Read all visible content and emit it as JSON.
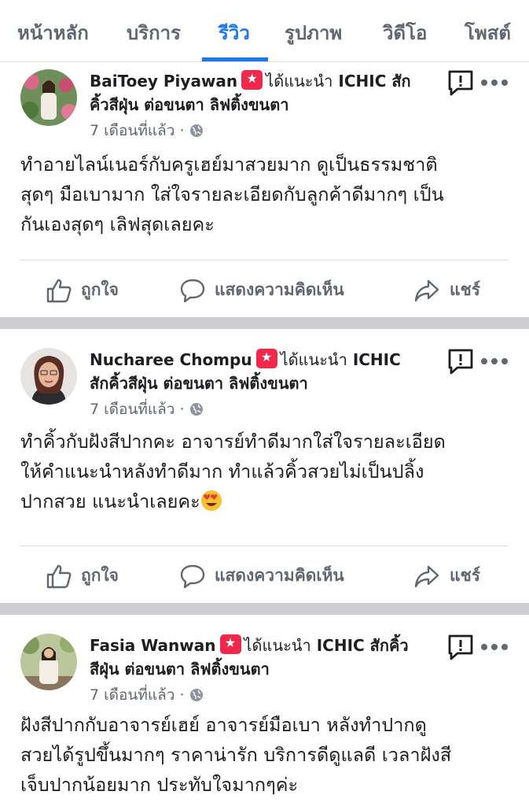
{
  "tabs": [
    {
      "label": "หน้าหลัก",
      "active": false
    },
    {
      "label": "บริการ",
      "active": false
    },
    {
      "label": "รีวิว",
      "active": true
    },
    {
      "label": "รูปภาพ",
      "active": false
    },
    {
      "label": "วิดีโอ",
      "active": false
    },
    {
      "label": "โพสต์",
      "active": false
    }
  ],
  "colors": {
    "accent": "#1877f2",
    "recommend": "#f02849",
    "meta": "#606770",
    "separator": "#cdced2"
  },
  "actions": {
    "like": "ถูกใจ",
    "comment": "แสดงความคิดเห็น",
    "share": "แชร์"
  },
  "reviews": [
    {
      "name": "BaiToey Piyawan",
      "recommend_text": "ได้แนะนำ",
      "page_line1": "ICHIC สัก",
      "page_line2": "คิ้วสีฝุ่น ต่อขนตา ลิฟติ้งขนตา",
      "time": "7 เดือนที่แล้ว",
      "text_lines": [
        "ทำอายไลน์เนอร์กับครูเฮย์มาสวยมาก ดูเป็นธรรมชาติ",
        "สุดๆ มือเบามาก ใส่ใจรายละเอียดกับลูกค้าดีมากๆ เป็น",
        "กันเองสุดๆ เลิฟสุดเลยคะ"
      ]
    },
    {
      "name": "Nucharee Chompu",
      "recommend_text": "ได้แนะนำ",
      "page_line1": "ICHIC",
      "page_line2": "สักคิ้วสีฝุ่น ต่อขนตา ลิฟติ้งขนตา",
      "time": "7 เดือนที่แล้ว",
      "text_lines": [
        "ทำคิ้วกับฝังสีปากคะ อาจารย์ทำดีมากใส่ใจรายละเอียด",
        "ให้คำแนะนำหลังทำดีมาก ทำแล้วคิ้วสวยไม่เป็นปลิ้ง",
        "ปากสวย แนะนำเลยคะ"
      ],
      "emoji": "heart-eyes-emoji"
    },
    {
      "name": "Fasia Wanwan",
      "recommend_text": "ได้แนะนำ",
      "page_line1": "ICHIC สักคิ้ว",
      "page_line2": "สีฝุ่น ต่อขนตา ลิฟติ้งขนตา",
      "time": "7 เดือนที่แล้ว",
      "text_lines": [
        "ฝังสีปากกับอาจารย์เฮย์  อาจารย์มือเบา หลังทำปากดู",
        "สวยได้รูปขึ้นมากๆ ราคาน่ารัก บริการดีดูแลดี เวลาฝังสี",
        "เจ็บปากน้อยมาก ประทับใจมากๆค่ะ"
      ]
    }
  ]
}
